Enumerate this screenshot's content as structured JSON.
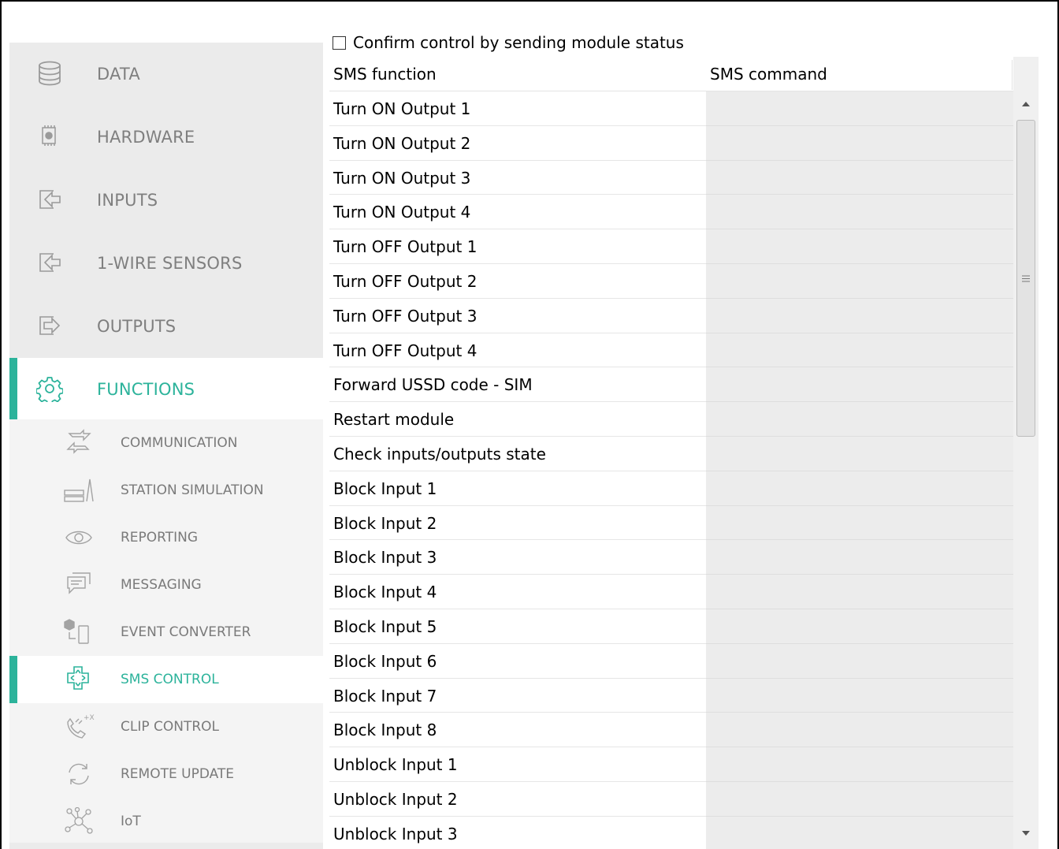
{
  "sidebar": {
    "main_items": [
      {
        "label": "DATA",
        "icon": "database-icon"
      },
      {
        "label": "HARDWARE",
        "icon": "chip-icon"
      },
      {
        "label": "INPUTS",
        "icon": "input-arrow-icon"
      },
      {
        "label": "1-WIRE SENSORS",
        "icon": "input-arrow-icon"
      },
      {
        "label": "OUTPUTS",
        "icon": "output-arrow-icon"
      },
      {
        "label": "FUNCTIONS",
        "icon": "gear-icon",
        "active": true
      }
    ],
    "sub_items": [
      {
        "label": "COMMUNICATION",
        "icon": "communication-arrows-icon"
      },
      {
        "label": "STATION SIMULATION",
        "icon": "station-icon"
      },
      {
        "label": "REPORTING",
        "icon": "eye-icon"
      },
      {
        "label": "MESSAGING",
        "icon": "chat-bubble-icon"
      },
      {
        "label": "EVENT CONVERTER",
        "icon": "event-converter-icon"
      },
      {
        "label": "SMS CONTROL",
        "icon": "sms-control-icon",
        "active": true
      },
      {
        "label": "CLIP CONTROL",
        "icon": "phone-icon"
      },
      {
        "label": "REMOTE UPDATE",
        "icon": "refresh-icon"
      },
      {
        "label": "IoT",
        "icon": "network-icon"
      }
    ]
  },
  "main": {
    "confirm_label": "Confirm control by sending module status",
    "confirm_checked": false,
    "columns": [
      "SMS function",
      "SMS command"
    ],
    "rows": [
      {
        "function": "Turn ON Output 1",
        "command": ""
      },
      {
        "function": "Turn ON Output 2",
        "command": ""
      },
      {
        "function": "Turn ON Output 3",
        "command": ""
      },
      {
        "function": "Turn ON Output 4",
        "command": ""
      },
      {
        "function": "Turn OFF Output 1",
        "command": ""
      },
      {
        "function": "Turn OFF Output 2",
        "command": ""
      },
      {
        "function": "Turn OFF Output 3",
        "command": ""
      },
      {
        "function": "Turn OFF Output 4",
        "command": ""
      },
      {
        "function": "Forward USSD code - SIM",
        "command": ""
      },
      {
        "function": "Restart module",
        "command": ""
      },
      {
        "function": "Check inputs/outputs state",
        "command": ""
      },
      {
        "function": "Block Input 1",
        "command": ""
      },
      {
        "function": "Block Input 2",
        "command": ""
      },
      {
        "function": "Block Input 3",
        "command": ""
      },
      {
        "function": "Block Input 4",
        "command": ""
      },
      {
        "function": "Block Input 5",
        "command": ""
      },
      {
        "function": "Block Input 6",
        "command": ""
      },
      {
        "function": "Block Input 7",
        "command": ""
      },
      {
        "function": "Block Input 8",
        "command": ""
      },
      {
        "function": "Unblock Input 1",
        "command": ""
      },
      {
        "function": "Unblock Input 2",
        "command": ""
      },
      {
        "function": "Unblock Input 3",
        "command": ""
      }
    ]
  },
  "colors": {
    "accent": "#2cb39b",
    "sidebar_bg": "#ebebeb",
    "sub_bg": "#f4f4f4",
    "command_cell": "#ececec"
  }
}
